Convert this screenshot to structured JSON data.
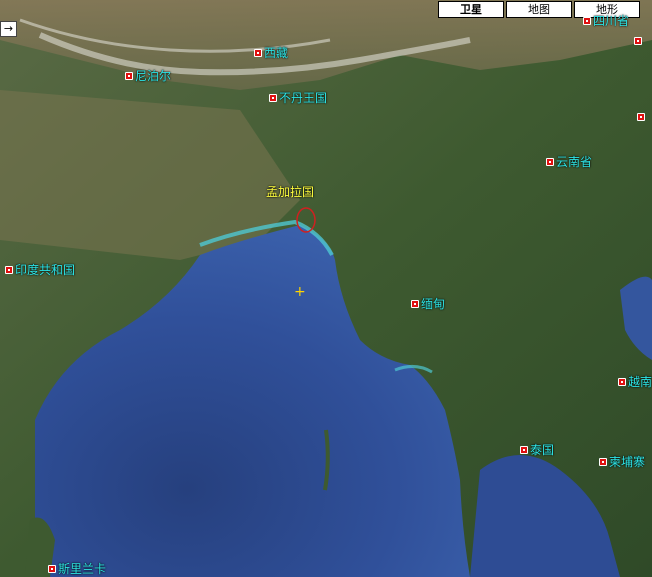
{
  "map_type_buttons": {
    "satellite": "卫星",
    "map": "地图",
    "terrain": "地形"
  },
  "nav": {
    "arrow": "→"
  },
  "places": {
    "xizang": "西藏",
    "nepal": "尼泊尔",
    "bhutan": "不丹王国",
    "bangladesh": "孟加拉国",
    "yunnan": "云南省",
    "india": "印度共和国",
    "myanmar": "缅甸",
    "vietnam": "越南",
    "thailand": "泰国",
    "cambodia": "柬埔寨",
    "srilanka": "斯里兰卡",
    "sichuan": "四川省"
  },
  "colors": {
    "label": "#2ee6e6",
    "label_highlight": "#ffff40",
    "pin": "#e01010",
    "ocean": "#2f4d8f",
    "land": "#3c5a2e"
  }
}
